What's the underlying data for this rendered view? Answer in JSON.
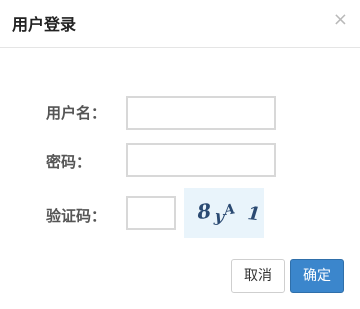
{
  "dialog": {
    "title": "用户登录",
    "close_glyph": "×",
    "fields": {
      "username_label": "用户名：",
      "username_value": "",
      "password_label": "密码：",
      "password_value": "",
      "captcha_label": "验证码：",
      "captcha_value": ""
    },
    "captcha_text": "8 yA 1",
    "buttons": {
      "cancel": "取消",
      "confirm": "确定"
    }
  },
  "colors": {
    "primary_button": "#3b86cc",
    "captcha_bg": "#e9f4fb"
  }
}
